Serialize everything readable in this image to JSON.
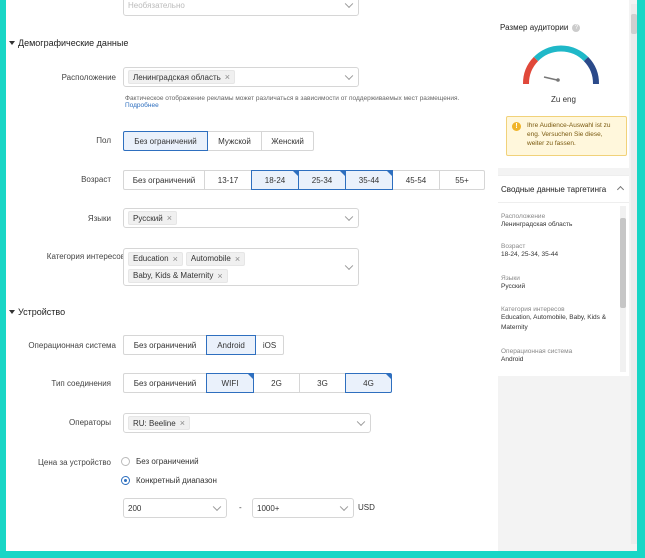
{
  "top_field": {
    "placeholder": "Необязательно"
  },
  "demographics": {
    "title": "Демографические данные",
    "location": {
      "label": "Расположение",
      "chip": "Ленинградская область"
    },
    "hint": "Фактическое отображение рекламы может различаться в зависимости от поддерживаемых мест размещения.",
    "hint_link": "Подробнее",
    "gender": {
      "label": "Пол",
      "options": [
        "Без ограничений",
        "Мужской",
        "Женский"
      ],
      "selected": "Без ограничений"
    },
    "age": {
      "label": "Возраст",
      "options": [
        "Без ограничений",
        "13-17",
        "18-24",
        "25-34",
        "35-44",
        "45-54",
        "55+"
      ],
      "selected": [
        "18-24",
        "25-34",
        "35-44"
      ]
    },
    "languages": {
      "label": "Языки",
      "chip": "Русский"
    },
    "interests": {
      "label": "Категория интересов",
      "chips": [
        "Education",
        "Automobile",
        "Baby, Kids & Maternity"
      ]
    }
  },
  "device": {
    "title": "Устройство",
    "os": {
      "label": "Операционная система",
      "options": [
        "Без ограничений",
        "Android",
        "iOS"
      ],
      "selected": "Android"
    },
    "connection": {
      "label": "Тип соединения",
      "options": [
        "Без ограничений",
        "WIFI",
        "2G",
        "3G",
        "4G"
      ],
      "selected": [
        "WIFI",
        "4G"
      ]
    },
    "carriers": {
      "label": "Операторы",
      "chip": "RU: Beeline"
    },
    "price": {
      "label": "Цена за устройство",
      "option_any": "Без ограничений",
      "option_range": "Конкретный диапазон",
      "selected": "Конкретный диапазон",
      "from": "200",
      "dash": "-",
      "to": "1000+",
      "currency": "USD"
    }
  },
  "audience": {
    "title": "Размер аудитории",
    "info_icon": "?",
    "gauge_label": "Zu eng",
    "warning": "Ihre Audience-Auswahl ist zu eng. Versuchen Sie diese, weiter zu fassen.",
    "warning_icon": "!"
  },
  "summary": {
    "title": "Сводные данные таргетинга",
    "items": [
      {
        "label": "Расположение",
        "value": "Ленинградская область"
      },
      {
        "label": "Возраст",
        "value": "18-24, 25-34, 35-44"
      },
      {
        "label": "Языки",
        "value": "Русский"
      },
      {
        "label": "Категория интересов",
        "value": "Education, Automobile, Baby, Kids & Maternity"
      },
      {
        "label": "Операционная система",
        "value": "Android"
      }
    ]
  },
  "colors": {
    "accent": "#2e6fbf",
    "frame": "#19d6c6",
    "gauge_teal": "#1fb8c8",
    "gauge_red": "#e0483a",
    "gauge_navy": "#2b4a8a"
  }
}
